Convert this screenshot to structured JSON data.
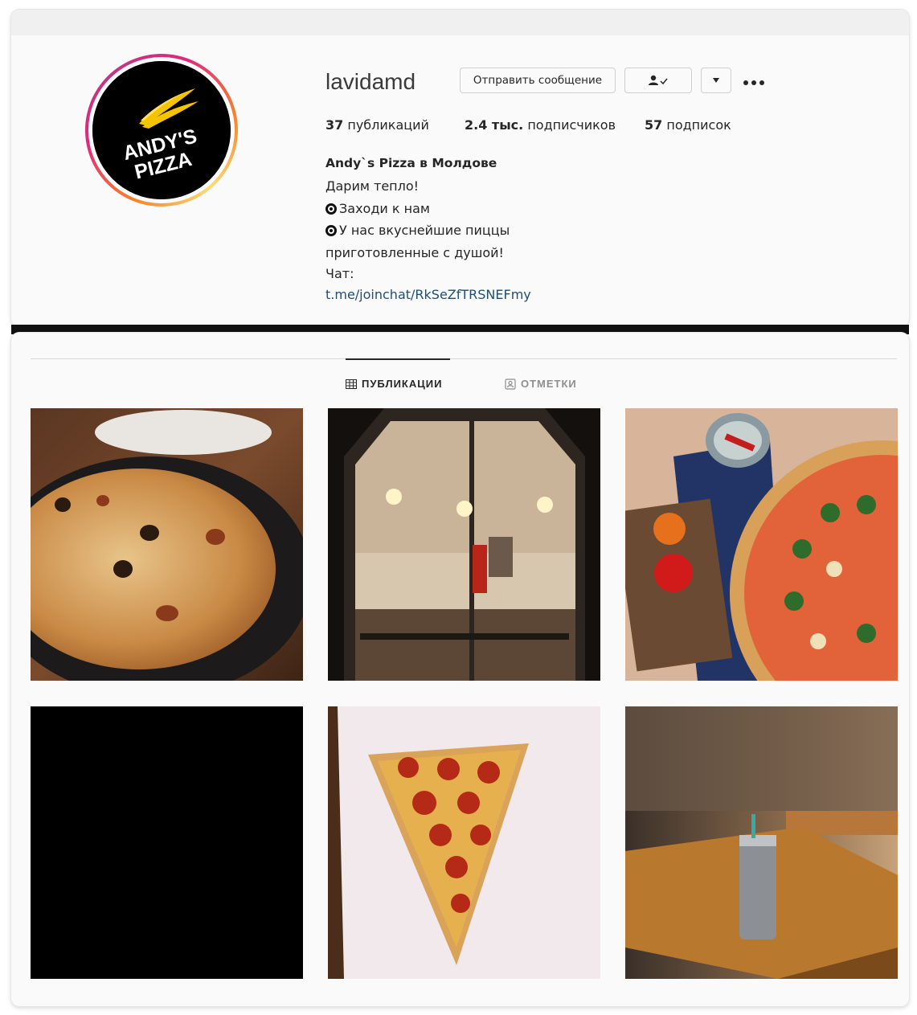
{
  "profile": {
    "username": "lavidamd",
    "logo_text_1": "ANDY'S",
    "logo_text_2": "PIZZA",
    "message_button": "Отправить сообщение",
    "stats": {
      "posts_count": "37",
      "posts_label": "публикаций",
      "followers_count": "2.4 тыс.",
      "followers_label": "подписчиков",
      "following_count": "57",
      "following_label": "подписок"
    },
    "bio": {
      "name": "Andy`s Pizza в Молдове",
      "line1": "Дарим тепло!",
      "line2": "Заходи к нам",
      "line3": "У нас вкуснейшие пиццы",
      "line4": "приготовленные с душой!",
      "line5": "Чат:",
      "link": "t.me/joinchat/RkSeZfTRSNEFmy"
    }
  },
  "tabs": [
    {
      "label": "ПУБЛИКАЦИИ",
      "icon": "grid-icon",
      "active": true
    },
    {
      "label": "ОТМЕТКИ",
      "icon": "tagged-icon",
      "active": false
    }
  ],
  "posts": [
    {
      "subject": "pizza-on-wooden-table"
    },
    {
      "subject": "pizzeria-storefront-night"
    },
    {
      "subject": "margherita-pizza-with-peppers"
    },
    {
      "subject": "black-image"
    },
    {
      "subject": "pepperoni-slice-on-paper"
    },
    {
      "subject": "cafe-table-with-tumbler"
    }
  ],
  "colors": {
    "accent_link": "#1f4e79",
    "story_ring": [
      "#f58529",
      "#dd2a7b",
      "#c13584"
    ],
    "logo_yellow": "#f5c400"
  }
}
